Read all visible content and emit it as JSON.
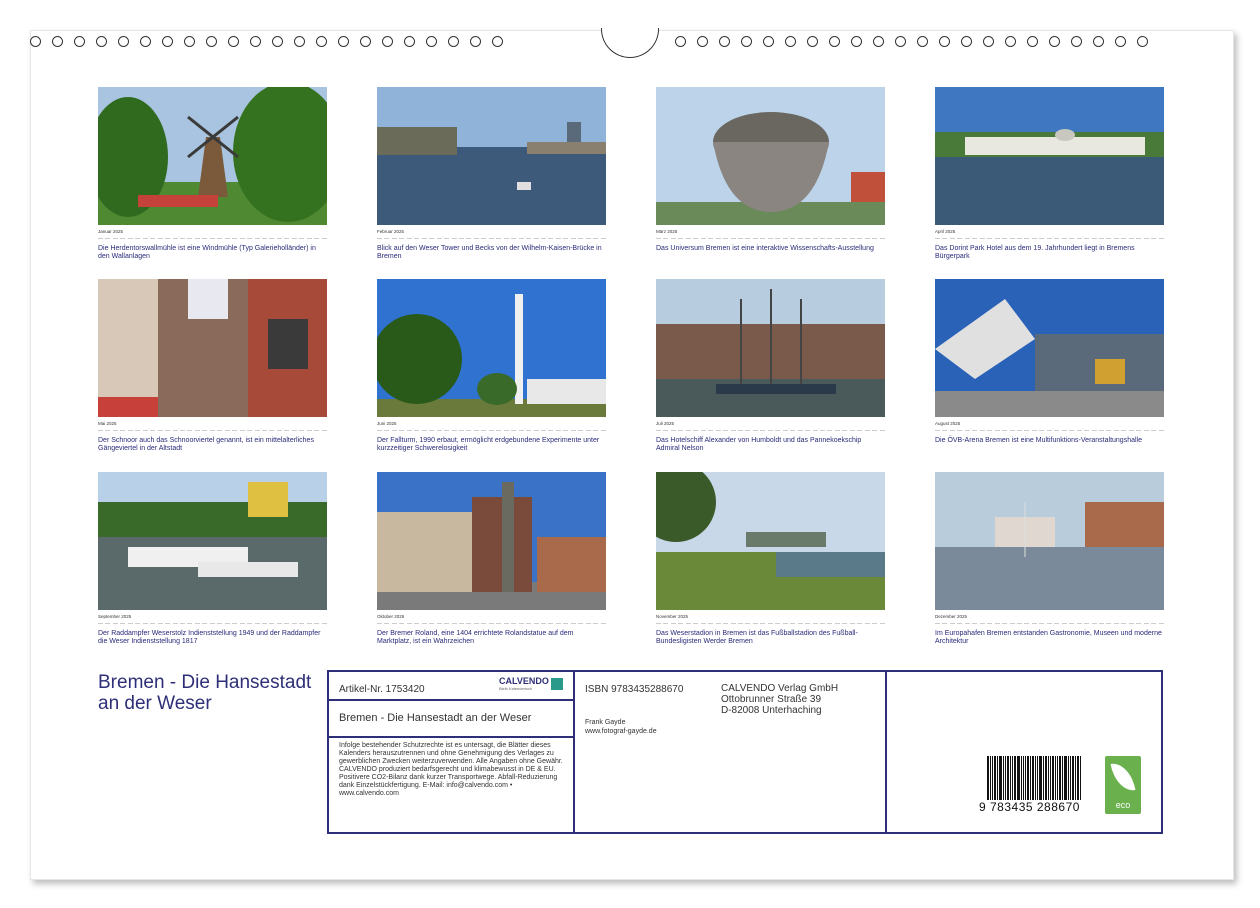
{
  "calendar_title": "Bremen - Die Hansestadt an der Weser",
  "months": [
    {
      "label": "Januar 2025",
      "caption": "Die Herdentorswallmühle ist eine Windmühle (Typ Galerieholländer) in den Wallanlagen"
    },
    {
      "label": "Februar 2025",
      "caption": "Blick auf den Weser Tower und Becks von der Wilhelm-Kaisen-Brücke in Bremen"
    },
    {
      "label": "März 2025",
      "caption": "Das Universum Bremen ist eine interaktive Wissenschafts-Ausstellung"
    },
    {
      "label": "April 2025",
      "caption": "Das Dorint Park Hotel aus dem 19. Jahrhundert liegt in Bremens Bürgerpark"
    },
    {
      "label": "Mai 2025",
      "caption": "Der Schnoor auch das Schnoorviertel genannt, ist ein mittelalterliches Gängeviertel in der Altstadt"
    },
    {
      "label": "Juni 2025",
      "caption": "Der Fallturm, 1990 erbaut, ermöglicht erdgebundene Experimente unter kurzzeitiger Schwerelosigkeit"
    },
    {
      "label": "Juli 2025",
      "caption": "Das Hotelschiff Alexander von Humboldt und das Pannekoekschip Admiral Nelson"
    },
    {
      "label": "August 2025",
      "caption": "Die ÖVB-Arena Bremen ist eine Multifunktions-Veranstaltungshalle"
    },
    {
      "label": "September 2025",
      "caption": "Der Raddampfer Weserstolz Indienststellung 1949 und der Raddampfer die Weser Indienststellung 1817"
    },
    {
      "label": "Oktober 2025",
      "caption": "Der Bremer Roland, eine 1404 errichtete Rolandstatue auf dem Marktplatz, ist ein Wahrzeichen"
    },
    {
      "label": "November 2025",
      "caption": "Das Weserstadion in Bremen ist das Fußballstadion des Fußball-Bundesligisten Werder Bremen"
    },
    {
      "label": "Dezember 2025",
      "caption": "Im Europahafen Bremen entstanden Gastronomie, Museen und moderne Architektur"
    }
  ],
  "info": {
    "article": "Artikel-Nr. 1753420",
    "brand": "CALVENDO",
    "brand_sub": "Bleib Kalenderisch",
    "title": "Bremen - Die Hansestadt an der Weser",
    "legal": "Infolge bestehender Schutzrechte ist es untersagt, die Blätter dieses Kalenders herauszutrennen und ohne Genehmigung des Verlages zu gewerblichen Zwecken weiterzuverwenden. Alle Angaben ohne Gewähr. CALVENDO produziert bedarfsgerecht und klimabewusst in DE & EU. Positivere CO2-Bilanz dank kurzer Transportwege. Abfall-Reduzierung dank Einzelstückfertigung. E-Mail: info@calvendo.com • www.calvendo.com",
    "isbn": "ISBN 9783435288670",
    "author": "Frank Gayde",
    "author_web": "www.fotograf-gayde.de",
    "publisher_name": "CALVENDO Verlag GmbH",
    "publisher_street": "Ottobrunner Straße 39",
    "publisher_city": "D-82008 Unterhaching",
    "barcode_number": "9 783435 288670",
    "eco_label": "eco"
  }
}
